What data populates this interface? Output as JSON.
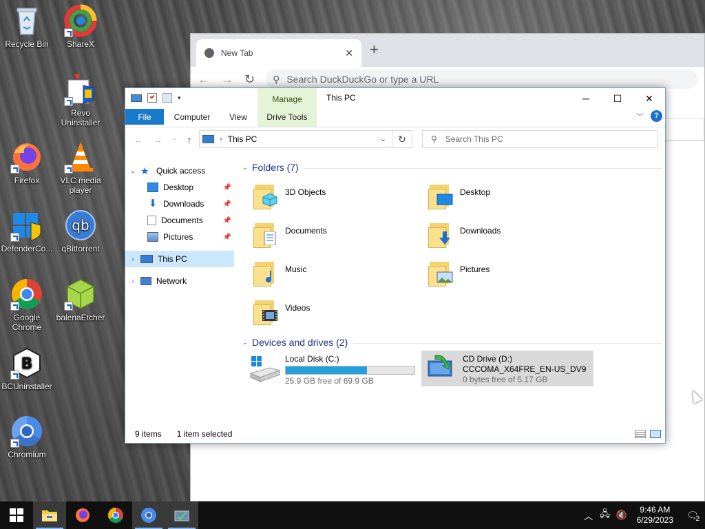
{
  "desktop": {
    "icons": [
      {
        "label": "Recycle Bin"
      },
      {
        "label": "ShareX"
      },
      {
        "label": "Revo Uninstaller"
      },
      {
        "label": "Firefox"
      },
      {
        "label": "VLC media player"
      },
      {
        "label": "DefenderCo..."
      },
      {
        "label": "qBittorrent"
      },
      {
        "label": "Google Chrome"
      },
      {
        "label": "balenaEtcher"
      },
      {
        "label": "BCUninstaller"
      },
      {
        "label": "Chromium"
      }
    ]
  },
  "browser": {
    "tab_title": "New Tab",
    "omnibox_placeholder": "Search DuckDuckGo or type a URL"
  },
  "explorer": {
    "title": "This PC",
    "context_tab": "Manage",
    "context_subtab": "Drive Tools",
    "ribbon_tabs": {
      "file": "File",
      "computer": "Computer",
      "view": "View"
    },
    "address": "This PC",
    "search_placeholder": "Search This PC",
    "nav": {
      "quick_access": "Quick access",
      "items": [
        "Desktop",
        "Downloads",
        "Documents",
        "Pictures"
      ],
      "this_pc": "This PC",
      "network": "Network"
    },
    "folders_header": "Folders (7)",
    "folders": [
      "3D Objects",
      "Desktop",
      "Documents",
      "Downloads",
      "Music",
      "Pictures",
      "Videos"
    ],
    "devices_header": "Devices and drives (2)",
    "drives": [
      {
        "name": "Local Disk (C:)",
        "detail": "25.9 GB free of 69.9 GB",
        "used_fraction": 0.63
      },
      {
        "name": "CD Drive (D:)",
        "label": "CCCOMA_X64FRE_EN-US_DV9",
        "detail": "0 bytes free of 5.17 GB"
      }
    ],
    "status": {
      "items": "9 items",
      "selected": "1 item selected"
    }
  },
  "taskbar": {
    "time": "9:46 AM",
    "date": "6/29/2023",
    "notification_count": "2"
  },
  "colors": {
    "accent": "#1979ca",
    "manage_tab_bg": "#e5f3d6",
    "selection": "#cce8ff",
    "drive_bar": "#26a0da"
  }
}
